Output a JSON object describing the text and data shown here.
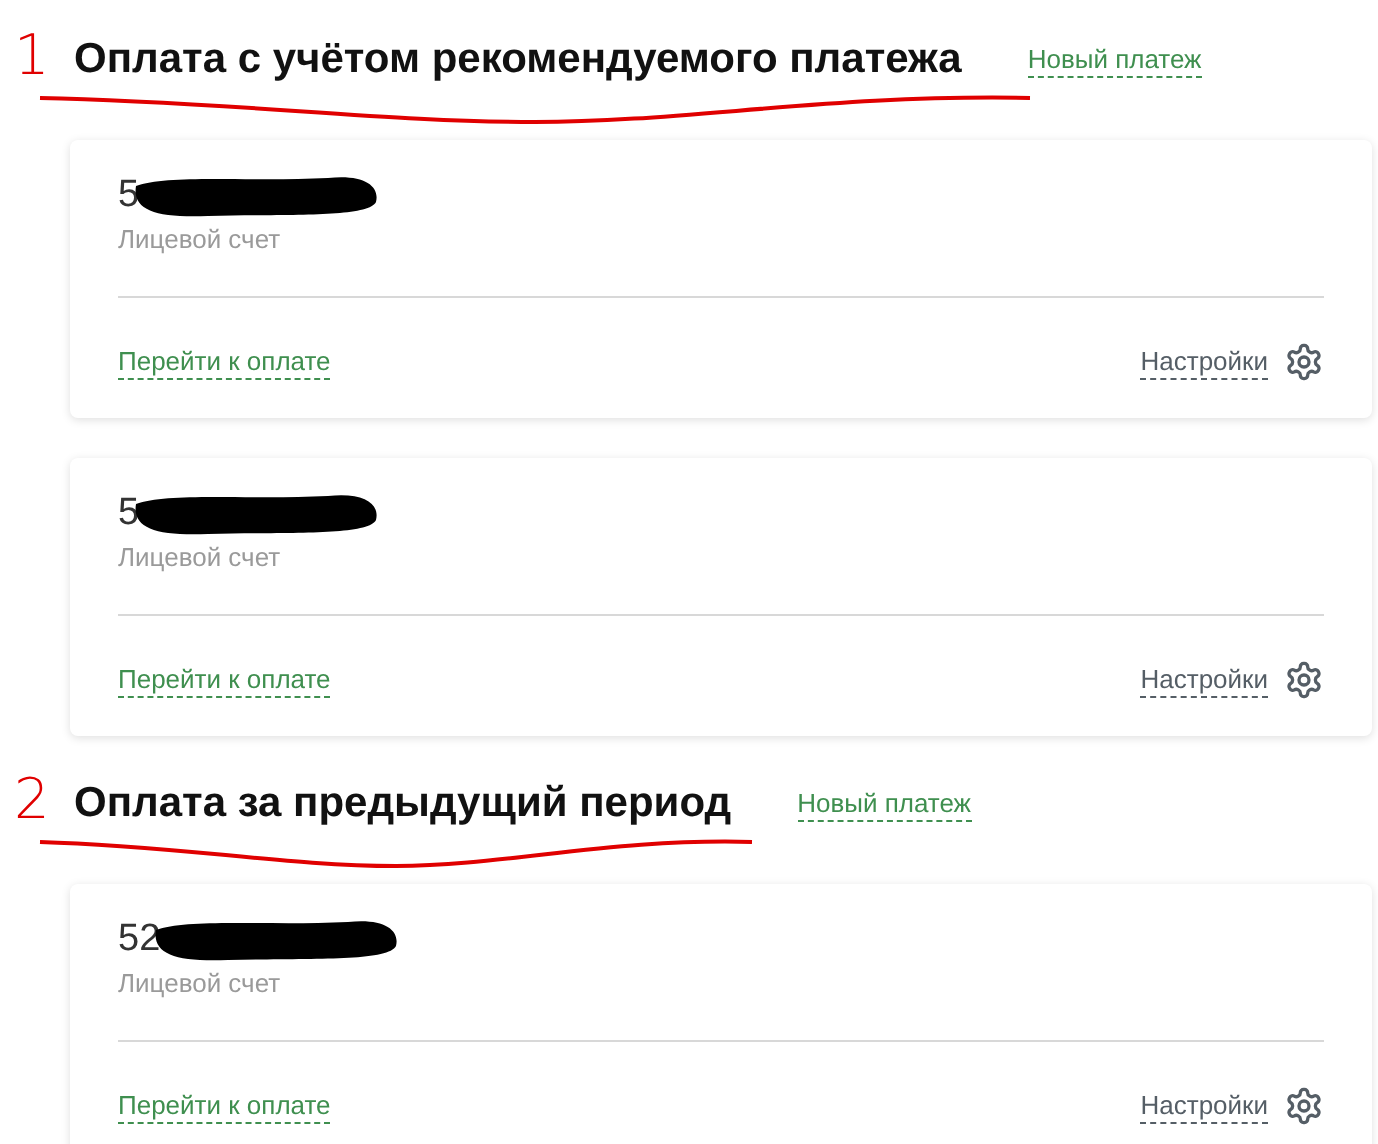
{
  "sections": [
    {
      "annotation": {
        "number": "1"
      },
      "title": "Оплата с учётом рекомендуемого платежа",
      "new_payment_link": "Новый платеж",
      "accounts": [
        {
          "number": "5",
          "redacted": true,
          "label": "Лицевой счет",
          "pay_link": "Перейти к оплате",
          "settings_link": "Настройки"
        },
        {
          "number": "5",
          "redacted": true,
          "label": "Лицевой счет",
          "pay_link": "Перейти к оплате",
          "settings_link": "Настройки"
        }
      ]
    },
    {
      "annotation": {
        "number": "2"
      },
      "title": "Оплата за предыдущий период",
      "new_payment_link": "Новый платеж",
      "accounts": [
        {
          "number": "52",
          "redacted": true,
          "label": "Лицевой счет",
          "pay_link": "Перейти к оплате",
          "settings_link": "Настройки"
        }
      ]
    }
  ]
}
